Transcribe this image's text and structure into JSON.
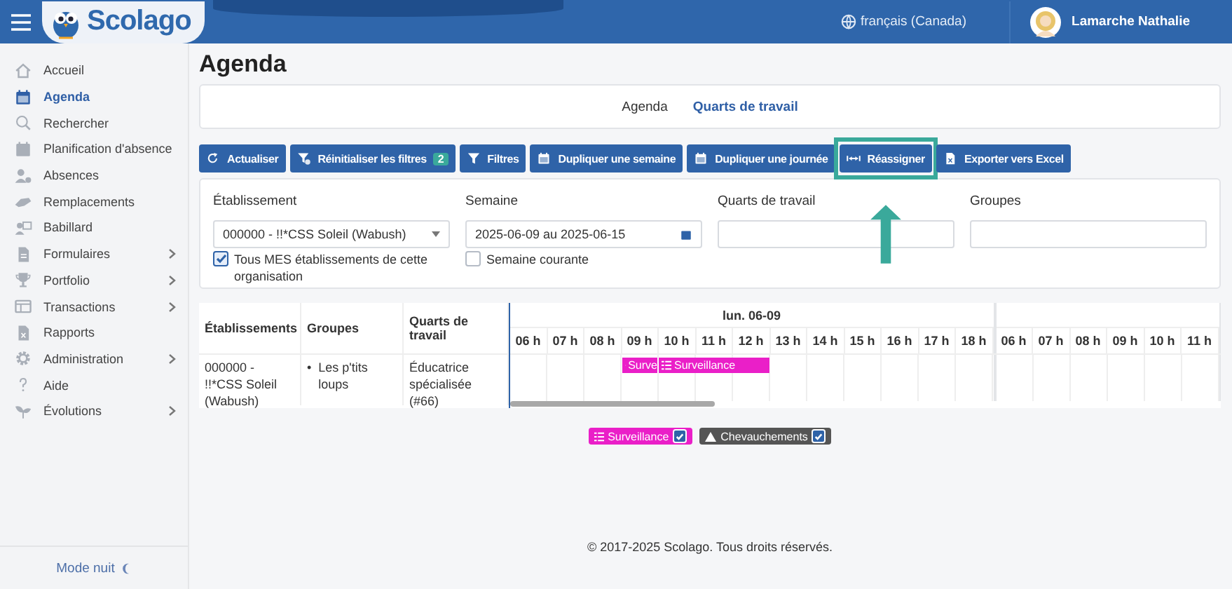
{
  "header": {
    "brand": "Scolago",
    "language": "français (Canada)",
    "user": "Lamarche Nathalie"
  },
  "sidebar": {
    "items": [
      {
        "label": "Accueil",
        "selected": false,
        "expandable": false
      },
      {
        "label": "Agenda",
        "selected": true,
        "expandable": false
      },
      {
        "label": "Rechercher",
        "selected": false,
        "expandable": false
      },
      {
        "label": "Planification d'absence",
        "selected": false,
        "expandable": false
      },
      {
        "label": "Absences",
        "selected": false,
        "expandable": false
      },
      {
        "label": "Remplacements",
        "selected": false,
        "expandable": false
      },
      {
        "label": "Babillard",
        "selected": false,
        "expandable": false
      },
      {
        "label": "Formulaires",
        "selected": false,
        "expandable": true
      },
      {
        "label": "Portfolio",
        "selected": false,
        "expandable": true
      },
      {
        "label": "Transactions",
        "selected": false,
        "expandable": true
      },
      {
        "label": "Rapports",
        "selected": false,
        "expandable": false
      },
      {
        "label": "Administration",
        "selected": false,
        "expandable": true
      },
      {
        "label": "Aide",
        "selected": false,
        "expandable": false
      },
      {
        "label": "Évolutions",
        "selected": false,
        "expandable": true
      }
    ],
    "footer": "Mode nuit"
  },
  "page_title": "Agenda",
  "tabs": [
    {
      "label": "Agenda",
      "selected": false
    },
    {
      "label": "Quarts de travail",
      "selected": true
    }
  ],
  "toolbar": [
    {
      "label": "Actualiser",
      "highlighted": false
    },
    {
      "label": "Réinitialiser les filtres",
      "badge": "2",
      "highlighted": false
    },
    {
      "label": "Filtres",
      "highlighted": false
    },
    {
      "label": "Dupliquer une semaine",
      "highlighted": false
    },
    {
      "label": "Dupliquer une journée",
      "highlighted": false
    },
    {
      "label": "Réassigner",
      "highlighted": true
    },
    {
      "label": "Exporter vers Excel",
      "highlighted": false
    }
  ],
  "filters": [
    {
      "kind": "select",
      "label": "Établissement",
      "value": "000000 - !!*CSS Soleil (Wabush)",
      "checkbox": {
        "label": "Tous MES établissements de cette organisation",
        "checked": true
      }
    },
    {
      "kind": "date",
      "label": "Semaine",
      "value": "2025-06-09 au 2025-06-15",
      "checkbox": {
        "label": "Semaine courante",
        "checked": false
      }
    },
    {
      "kind": "text",
      "label": "Quarts de travail"
    },
    {
      "kind": "text",
      "label": "Groupes"
    }
  ],
  "table": {
    "columns": [
      "Établissements",
      "Groupes",
      "Quarts de travail"
    ],
    "days": [
      {
        "label": "lun. 06-09",
        "hours": [
          "06 h",
          "07 h",
          "08 h",
          "09 h",
          "10 h",
          "11 h",
          "12 h",
          "13 h",
          "14 h",
          "15 h",
          "16 h",
          "17 h",
          "18 h"
        ]
      },
      {
        "hours": [
          "06 h",
          "07 h",
          "08 h",
          "09 h",
          "10 h",
          "11 h"
        ]
      }
    ],
    "rows": [
      {
        "establishment": "000000 - !!*CSS Soleil (Wabush)",
        "groups": [
          {
            "marker": "•",
            "label": "Les p'tits loups"
          }
        ],
        "shift": "Éducatrice spécialisée (#66)",
        "slots": [
          {
            "kind": "empty"
          },
          {
            "kind": "empty"
          },
          {
            "kind": "empty"
          },
          {
            "kind": "event",
            "label": "Surve",
            "color": "#ea1fc8"
          },
          {
            "kind": "event",
            "label": "Surveillance",
            "color": "#ea1fc8"
          },
          {
            "kind": "continued"
          },
          {
            "kind": "continued"
          },
          {
            "kind": "empty"
          },
          {
            "kind": "empty"
          },
          {
            "kind": "empty"
          },
          {
            "kind": "empty"
          },
          {
            "kind": "empty"
          },
          {
            "kind": "empty"
          }
        ]
      }
    ]
  },
  "legend": [
    {
      "label": "Surveillance",
      "kind": "shift",
      "color": "#ea1fc8",
      "checked": true
    },
    {
      "label": "Chevauchements",
      "kind": "overlap",
      "color": "#555555",
      "checked": true
    }
  ],
  "footer": "© 2017-2025 Scolago. Tous droits réservés."
}
